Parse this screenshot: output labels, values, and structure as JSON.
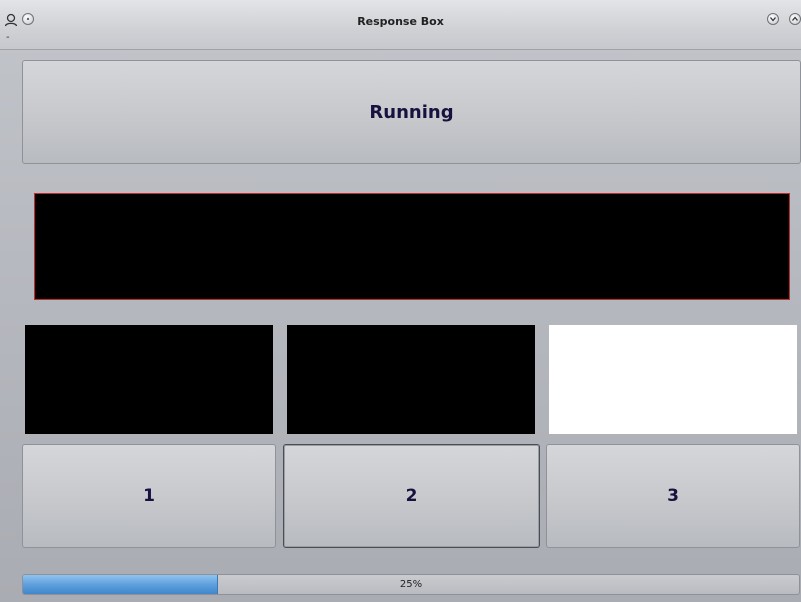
{
  "window": {
    "title": "Response Box",
    "dash_label": "-"
  },
  "main_button": {
    "label": "Running"
  },
  "response_buttons": [
    {
      "label": "1"
    },
    {
      "label": "2"
    },
    {
      "label": "3"
    }
  ],
  "progress": {
    "value_percent": 25,
    "text": "25%"
  },
  "colors": {
    "display_border": "#c42a2a",
    "progress_fill": "#5fa0dc",
    "button_text": "#16123f"
  },
  "icons": {
    "window_menu": "user-icon",
    "shade": "circle-icon",
    "minimize": "chevron-down-icon",
    "maximize": "chevron-up-icon"
  }
}
